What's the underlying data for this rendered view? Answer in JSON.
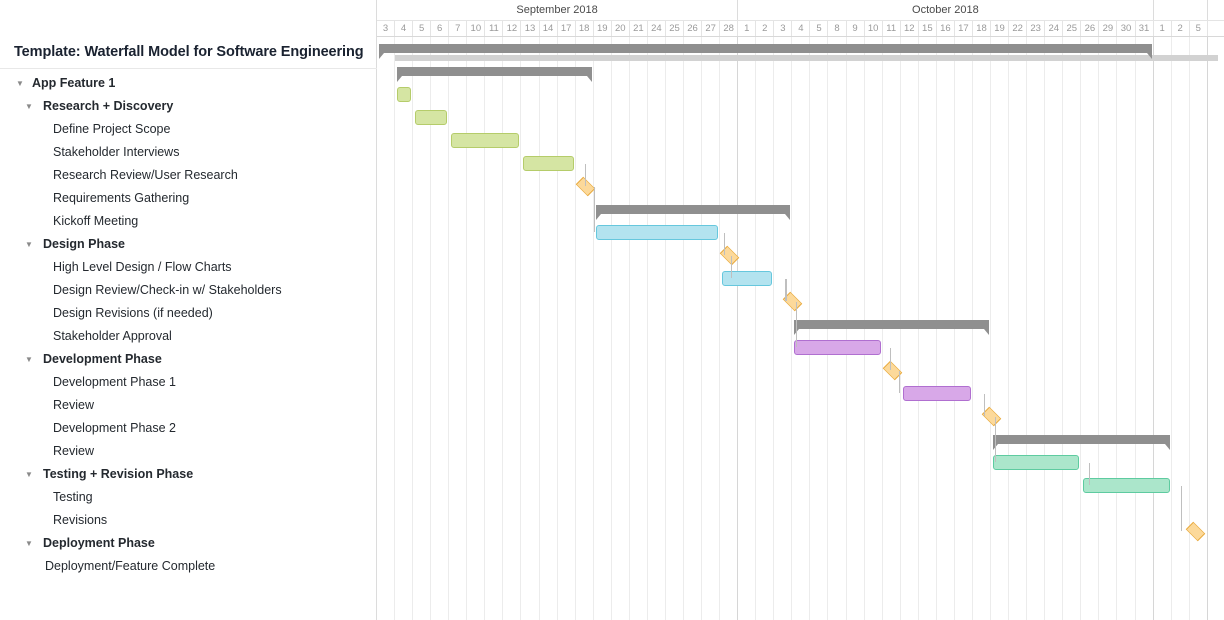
{
  "sheet": {
    "title": "Template: Waterfall Model for Software Engineering"
  },
  "icons": {
    "twisty_expanded": "▼"
  },
  "colors": {
    "summary_bar": "#8f8f8f",
    "summary_bar_light": "#d2d2d2",
    "milestone_fill": "#fcd99a",
    "milestone_border": "#e8a93c",
    "connector": "#bfbfbf",
    "grid_line": "#ececec",
    "research_fill": "#d5e5a3",
    "research_border": "#b5cc6a",
    "design_fill": "#b3e3ef",
    "design_border": "#66c7dd",
    "development_fill": "#d8a8e8",
    "development_border": "#b06fd0",
    "testing_fill": "#abe6cb",
    "testing_border": "#5ecba0"
  },
  "timeline": {
    "months": [
      {
        "label": "September 2018",
        "days": 20
      },
      {
        "label": "October 2018",
        "days": 23
      },
      {
        "label": "",
        "days": 3
      }
    ],
    "days": [
      "3",
      "4",
      "5",
      "6",
      "7",
      "10",
      "11",
      "12",
      "13",
      "14",
      "17",
      "18",
      "19",
      "20",
      "21",
      "24",
      "25",
      "26",
      "27",
      "28",
      "1",
      "2",
      "3",
      "4",
      "5",
      "8",
      "9",
      "10",
      "11",
      "12",
      "15",
      "16",
      "17",
      "18",
      "19",
      "22",
      "23",
      "24",
      "25",
      "26",
      "29",
      "30",
      "31",
      "1",
      "2",
      "5"
    ]
  },
  "rows": [
    {
      "label": "App Feature 1",
      "level": 0,
      "expanded": true,
      "type": "summary",
      "start": 0,
      "end": 43,
      "color": "summary_bar"
    },
    {
      "label": "Research + Discovery",
      "level": 1,
      "expanded": true,
      "type": "summary",
      "start": 1,
      "end": 12,
      "color": "summary_bar"
    },
    {
      "label": "Define Project Scope",
      "level": 2,
      "expanded": false,
      "type": "task",
      "start": 1,
      "end": 2,
      "color": "research"
    },
    {
      "label": "Stakeholder Interviews",
      "level": 2,
      "expanded": false,
      "type": "task",
      "start": 2,
      "end": 4,
      "color": "research"
    },
    {
      "label": "Research Review/User Research",
      "level": 2,
      "expanded": false,
      "type": "task",
      "start": 4,
      "end": 8,
      "color": "research"
    },
    {
      "label": "Requirements Gathering",
      "level": 2,
      "expanded": false,
      "type": "task",
      "start": 8,
      "end": 11,
      "color": "research"
    },
    {
      "label": "Kickoff Meeting",
      "level": 2,
      "expanded": false,
      "type": "milestone",
      "start": 11.5,
      "end": 11.5,
      "color": "milestone"
    },
    {
      "label": "Design Phase",
      "level": 1,
      "expanded": true,
      "type": "summary",
      "start": 12,
      "end": 23,
      "color": "summary_bar"
    },
    {
      "label": "High Level Design / Flow Charts",
      "level": 2,
      "expanded": false,
      "type": "task",
      "start": 12,
      "end": 19,
      "color": "design"
    },
    {
      "label": "Design Review/Check-in w/ Stakeholders",
      "level": 2,
      "expanded": false,
      "type": "milestone",
      "start": 19.5,
      "end": 19.5,
      "color": "milestone"
    },
    {
      "label": "Design Revisions (if needed)",
      "level": 2,
      "expanded": false,
      "type": "task",
      "start": 19,
      "end": 22,
      "color": "design"
    },
    {
      "label": "Stakeholder Approval",
      "level": 2,
      "expanded": false,
      "type": "milestone",
      "start": 23,
      "end": 23,
      "color": "milestone"
    },
    {
      "label": "Development Phase",
      "level": 1,
      "expanded": true,
      "type": "summary",
      "start": 23,
      "end": 34,
      "color": "summary_bar"
    },
    {
      "label": "Development Phase 1",
      "level": 2,
      "expanded": false,
      "type": "task",
      "start": 23,
      "end": 28,
      "color": "development"
    },
    {
      "label": "Review",
      "level": 2,
      "expanded": false,
      "type": "milestone",
      "start": 28.5,
      "end": 28.5,
      "color": "milestone"
    },
    {
      "label": "Development Phase 2",
      "level": 2,
      "expanded": false,
      "type": "task",
      "start": 29,
      "end": 33,
      "color": "development"
    },
    {
      "label": "Review",
      "level": 2,
      "expanded": false,
      "type": "milestone",
      "start": 34,
      "end": 34,
      "color": "milestone"
    },
    {
      "label": "Testing + Revision Phase",
      "level": 1,
      "expanded": true,
      "type": "summary",
      "start": 34,
      "end": 44,
      "color": "summary_bar"
    },
    {
      "label": "Testing",
      "level": 2,
      "expanded": false,
      "type": "task",
      "start": 34,
      "end": 39,
      "color": "testing"
    },
    {
      "label": "Revisions",
      "level": 2,
      "expanded": false,
      "type": "task",
      "start": 39,
      "end": 44,
      "color": "testing"
    },
    {
      "label": "Deployment Phase",
      "level": 1,
      "expanded": true,
      "type": "none",
      "start": 0,
      "end": 0,
      "color": ""
    },
    {
      "label": "Deployment/Feature Complete",
      "level": 3,
      "expanded": false,
      "type": "milestone",
      "start": 45.3,
      "end": 45.3,
      "color": "milestone"
    }
  ],
  "connectors": [
    {
      "from_row": 5,
      "to_row": 6,
      "x": 11.5
    },
    {
      "from_row": 6,
      "to_row": 8,
      "x": 12.0
    },
    {
      "from_row": 8,
      "to_row": 9,
      "x": 19.2
    },
    {
      "from_row": 9,
      "to_row": 10,
      "x": 19.6
    },
    {
      "from_row": 10,
      "to_row": 11,
      "x": 22.6
    },
    {
      "from_row": 11,
      "to_row": 13,
      "x": 23.2
    },
    {
      "from_row": 13,
      "to_row": 14,
      "x": 28.4
    },
    {
      "from_row": 14,
      "to_row": 15,
      "x": 28.9
    },
    {
      "from_row": 15,
      "to_row": 16,
      "x": 33.6
    },
    {
      "from_row": 16,
      "to_row": 18,
      "x": 34.2
    },
    {
      "from_row": 18,
      "to_row": 19,
      "x": 39.4
    },
    {
      "from_row": 19,
      "to_row": 21,
      "x": 44.5
    }
  ]
}
